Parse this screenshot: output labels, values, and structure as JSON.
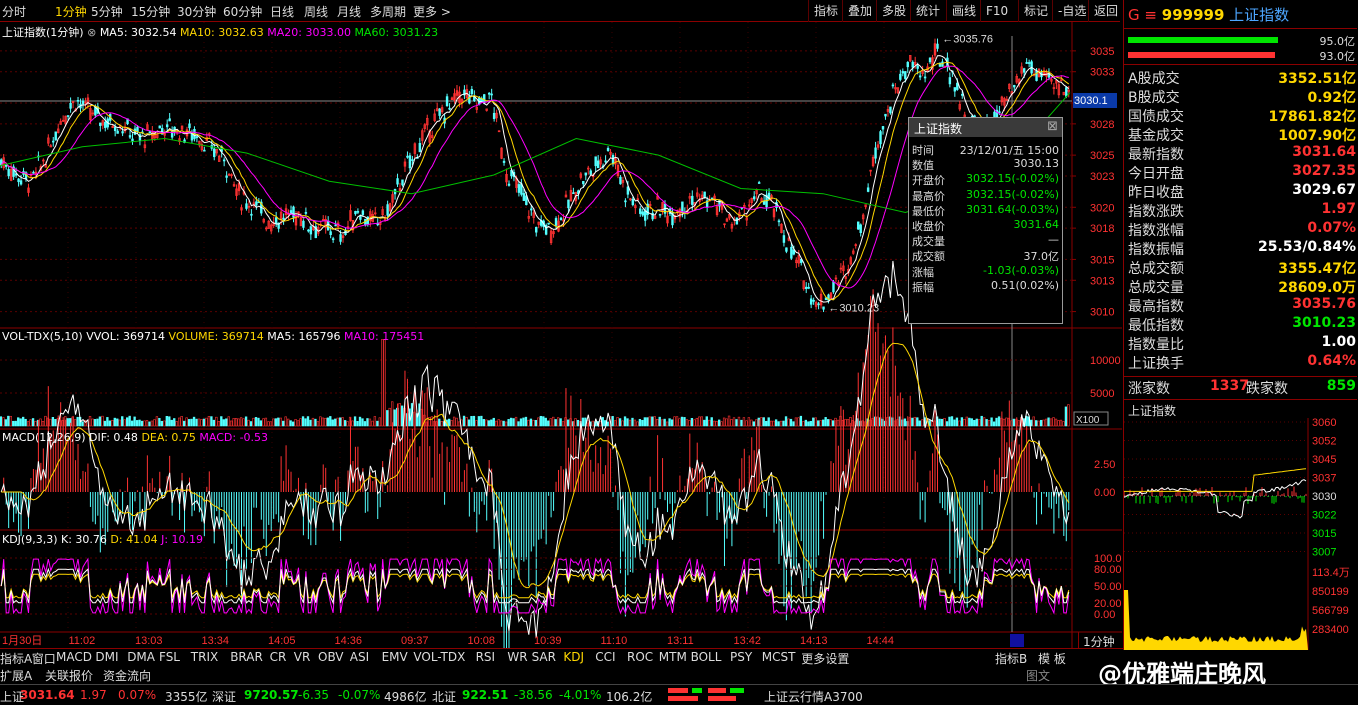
{
  "period_tabs": [
    "分时",
    "1分钟",
    "5分钟",
    "15分钟",
    "30分钟",
    "60分钟",
    "日线",
    "周线",
    "月线",
    "多周期",
    "更多 >"
  ],
  "active_period": "1分钟",
  "toolbar_buttons": [
    "指标",
    "叠加",
    "多股",
    "统计",
    "画线",
    "F10",
    "标记",
    "-自选",
    "返回"
  ],
  "main_info": {
    "name": "上证指数(1分钟)",
    "ma5": "MA5: 3032.54",
    "ma10": "MA10: 3032.63",
    "ma20": "MA20: 3033.00",
    "ma60": "MA60: 3031.23"
  },
  "price_axis": [
    "3035",
    "3033",
    "3030",
    "3028",
    "3025",
    "3023",
    "3020",
    "3018",
    "3015",
    "3013",
    "3010"
  ],
  "current_price_tag": "3030.1",
  "high_label": "3035.76",
  "low_label": "3010.23",
  "vol_info": {
    "name": "VOL-TDX(5,10)",
    "vvol": "VVOL: 369714",
    "volume": "VOLUME: 369714",
    "ma5": "MA5: 165796",
    "ma10": "MA10: 175451"
  },
  "vol_axis": [
    "10000",
    "5000"
  ],
  "vol_unit": "X100",
  "macd_info": {
    "name": "MACD(12,26,9)",
    "dif": "DIF: 0.48",
    "dea": "DEA: 0.75",
    "macd": "MACD: -0.53"
  },
  "macd_axis": [
    "2.50",
    "0.00"
  ],
  "kdj_info": {
    "name": "KDJ(9,3,3)",
    "k": "K: 30.76",
    "d": "D: 41.04",
    "j": "J: 10.19"
  },
  "kdj_axis": [
    "100.00",
    "80.00",
    "50.00",
    "20.00",
    "0.00"
  ],
  "time_axis": [
    "1月30日",
    "11:02",
    "13:03",
    "13:34",
    "14:05",
    "14:36",
    "09:37",
    "10:08",
    "10:39",
    "11:10",
    "13:11",
    "13:42",
    "14:13",
    "14:44"
  ],
  "popup": {
    "title": "上证指数",
    "rows": [
      {
        "k": "时间",
        "v": "23/12/01/五 15:00",
        "c": "#ddd"
      },
      {
        "k": "数值",
        "v": "3030.13",
        "c": "#ddd"
      },
      {
        "k": "开盘价",
        "v": "3032.15(-0.02%)",
        "c": "#00e600"
      },
      {
        "k": "最高价",
        "v": "3032.15(-0.02%)",
        "c": "#00e600"
      },
      {
        "k": "最低价",
        "v": "3031.64(-0.03%)",
        "c": "#00e600"
      },
      {
        "k": "收盘价",
        "v": "3031.64",
        "c": "#00e600"
      },
      {
        "k": "成交量",
        "v": "—",
        "c": "#ddd"
      },
      {
        "k": "成交额",
        "v": "37.0亿",
        "c": "#ddd"
      },
      {
        "k": "涨幅",
        "v": "-1.03(-0.03%)",
        "c": "#00e600"
      },
      {
        "k": "振幅",
        "v": "0.51(0.02%)",
        "c": "#ddd"
      }
    ]
  },
  "right_panel": {
    "g_label": "G",
    "menu_icon": "≡",
    "code": "999999",
    "name": "上证指数",
    "bar1": "95.0亿",
    "bar2": "93.0亿",
    "rows": [
      {
        "k": "A股成交",
        "v": "3352.51亿",
        "c": "#ffd700"
      },
      {
        "k": "B股成交",
        "v": "0.92亿",
        "c": "#ffd700"
      },
      {
        "k": "国债成交",
        "v": "17861.82亿",
        "c": "#ffd700"
      },
      {
        "k": "基金成交",
        "v": "1007.90亿",
        "c": "#ffd700"
      },
      {
        "k": "最新指数",
        "v": "3031.64",
        "c": "#ff3232"
      },
      {
        "k": "今日开盘",
        "v": "3027.35",
        "c": "#ff3232"
      },
      {
        "k": "昨日收盘",
        "v": "3029.67",
        "c": "#fff"
      },
      {
        "k": "指数涨跌",
        "v": "1.97",
        "c": "#ff3232"
      },
      {
        "k": "指数涨幅",
        "v": "0.07%",
        "c": "#ff3232"
      },
      {
        "k": "指数振幅",
        "v": "25.53/0.84%",
        "c": "#fff"
      },
      {
        "k": "总成交额",
        "v": "3355.47亿",
        "c": "#ffd700"
      },
      {
        "k": "总成交量",
        "v": "28609.0万",
        "c": "#ffd700"
      },
      {
        "k": "最高指数",
        "v": "3035.76",
        "c": "#ff3232"
      },
      {
        "k": "最低指数",
        "v": "3010.23",
        "c": "#00e600"
      },
      {
        "k": "指数量比",
        "v": "1.00",
        "c": "#fff"
      },
      {
        "k": "上证换手",
        "v": "0.64%",
        "c": "#ff3232"
      }
    ],
    "up_label": "涨家数",
    "up_value": "1337",
    "down_label": "跌家数",
    "down_value": "859",
    "mini_title": "上证指数",
    "mini_axis": [
      "3060",
      "3052",
      "3045",
      "3037",
      "3030",
      "3022",
      "3015",
      "3007"
    ],
    "mini_vol_axis": [
      "113.4万",
      "850199",
      "566799",
      "283400"
    ]
  },
  "bottom_tabs": [
    "指标A",
    "窗口",
    "MACD",
    "DMI",
    "DMA",
    "FSL",
    "TRIX",
    "BRAR",
    "CR",
    "VR",
    "OBV",
    "ASI",
    "EMV",
    "VOL-TDX",
    "RSI",
    "WR",
    "SAR",
    "KDJ",
    "CCI",
    "ROC",
    "MTM",
    "BOLL",
    "PSY",
    "MCST",
    "更多",
    "设置"
  ],
  "bottom_right": {
    "indicator_b": "指标B",
    "template": "模 板",
    "period": "1分钟"
  },
  "row2_tabs": [
    "扩展A",
    "关联报价",
    "资金流向"
  ],
  "tab_extra": "图文",
  "watermark": "@优雅端庄晚风",
  "status": {
    "sh_label": "上证",
    "sh_val": "3031.64",
    "sh_chg": "1.97",
    "sh_pct": "0.07%",
    "sh_amt": "3355亿",
    "sz_label": "深证",
    "sz_val": "9720.57",
    "sz_chg": "-6.35",
    "sz_pct": "-0.07%",
    "sz_amt": "4986亿",
    "bz_label": "北证",
    "bz_val": "922.51",
    "bz_chg": "-38.56",
    "bz_pct": "-4.01%",
    "bz_amt": "106.2亿",
    "ticker": "上证云行情A3700"
  },
  "chart_data": {
    "type": "candlestick",
    "price_range": [
      3009,
      3037
    ],
    "close": [
      3024.5,
      3023.2,
      3022.5,
      3024.8,
      3028.5,
      3030.4,
      3029,
      3028.3,
      3028,
      3026.8,
      3026.8,
      3027.8,
      3027.3,
      3027.1,
      3025.8,
      3024.7,
      3021.1,
      3020.2,
      3018.7,
      3019,
      3019.4,
      3018.2,
      3017.9,
      3017.4,
      3019.8,
      3018.4,
      3019.5,
      3022.9,
      3025.8,
      3027.9,
      3029.6,
      3030.9,
      3030,
      3030.4,
      3023.4,
      3021.3,
      3018.4,
      3017.9,
      3019.9,
      3022.6,
      3023.9,
      3025.7,
      3021.6,
      3019.7,
      3019.9,
      3019.5,
      3020.4,
      3020.9,
      3020.5,
      3018.3,
      3019.5,
      3021.3,
      3019.9,
      3016.2,
      3013.3,
      3010.5,
      3012.3,
      3014.4,
      3019.4,
      3026.7,
      3030.7,
      3033.8,
      3032.7,
      3034.7,
      3032.6,
      3028.4,
      3027.6,
      3028.7,
      3030.9,
      3033.8,
      3032.4,
      3031.6
    ],
    "ma60": [
      3024,
      3025.8,
      3026.6,
      3025.2,
      3022.5,
      3021.3,
      3023.1,
      3026.6,
      3025,
      3021.8,
      3021.3,
      3019.5,
      3022.1,
      3031
    ]
  }
}
